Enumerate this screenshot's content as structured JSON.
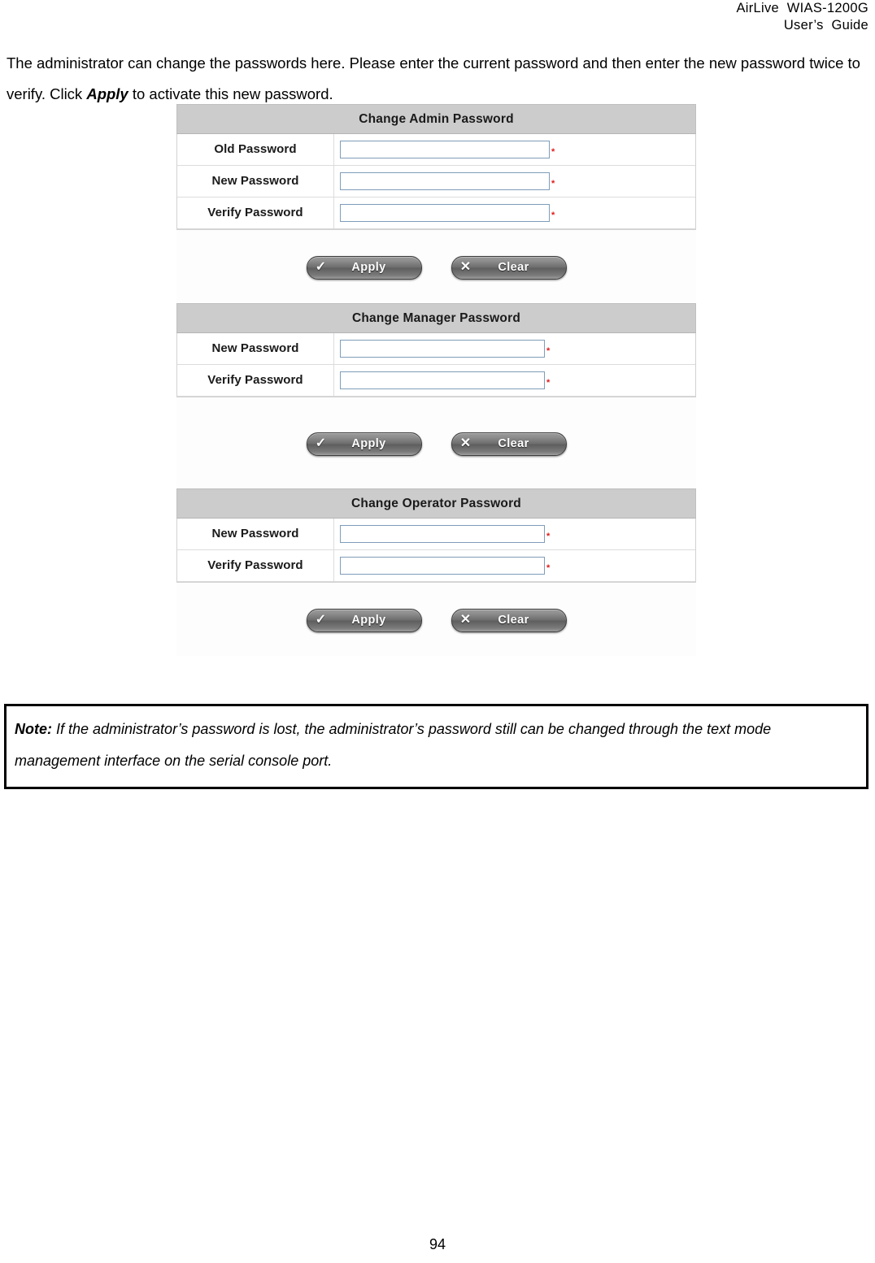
{
  "header": {
    "line1": "AirLive  WIAS-1200G",
    "line2": "User’s  Guide"
  },
  "intro": {
    "part1": "The administrator can change the passwords here. Please enter the current password and then enter the new password twice to verify. Click ",
    "emphasis": "Apply",
    "part2": " to activate this new password."
  },
  "screenshot": {
    "panels": [
      {
        "title": "Change Admin Password",
        "rows": [
          {
            "label": "Old Password",
            "value": "",
            "required_marker": "*"
          },
          {
            "label": "New Password",
            "value": "",
            "required_marker": "*"
          },
          {
            "label": "Verify Password",
            "value": "",
            "required_marker": "*"
          }
        ],
        "buttons": [
          {
            "icon": "check-icon",
            "glyph": "✓",
            "label": "Apply"
          },
          {
            "icon": "cross-icon",
            "glyph": "✕",
            "label": "Clear"
          }
        ]
      },
      {
        "title": "Change Manager Password",
        "rows": [
          {
            "label": "New Password",
            "value": "",
            "required_marker": "*"
          },
          {
            "label": "Verify Password",
            "value": "",
            "required_marker": "*"
          }
        ],
        "buttons": [
          {
            "icon": "check-icon",
            "glyph": "✓",
            "label": "Apply"
          },
          {
            "icon": "cross-icon",
            "glyph": "✕",
            "label": "Clear"
          }
        ]
      },
      {
        "title": "Change Operator Password",
        "rows": [
          {
            "label": "New Password",
            "value": "",
            "required_marker": "*"
          },
          {
            "label": "Verify Password",
            "value": "",
            "required_marker": "*"
          }
        ],
        "buttons": [
          {
            "icon": "check-icon",
            "glyph": "✓",
            "label": "Apply"
          },
          {
            "icon": "cross-icon",
            "glyph": "✕",
            "label": "Clear"
          }
        ]
      }
    ]
  },
  "note": {
    "tag": "Note:",
    "text": " If the administrator’s password is lost, the administrator’s password still can be changed through the text mode management interface on the serial console port."
  },
  "footer": {
    "page_number": "94"
  },
  "colors": {
    "panel_header_bg": "#cccccc",
    "input_border": "#7f9db9",
    "required_marker": "#e01b1b",
    "button_body": "#6d6d6d"
  }
}
